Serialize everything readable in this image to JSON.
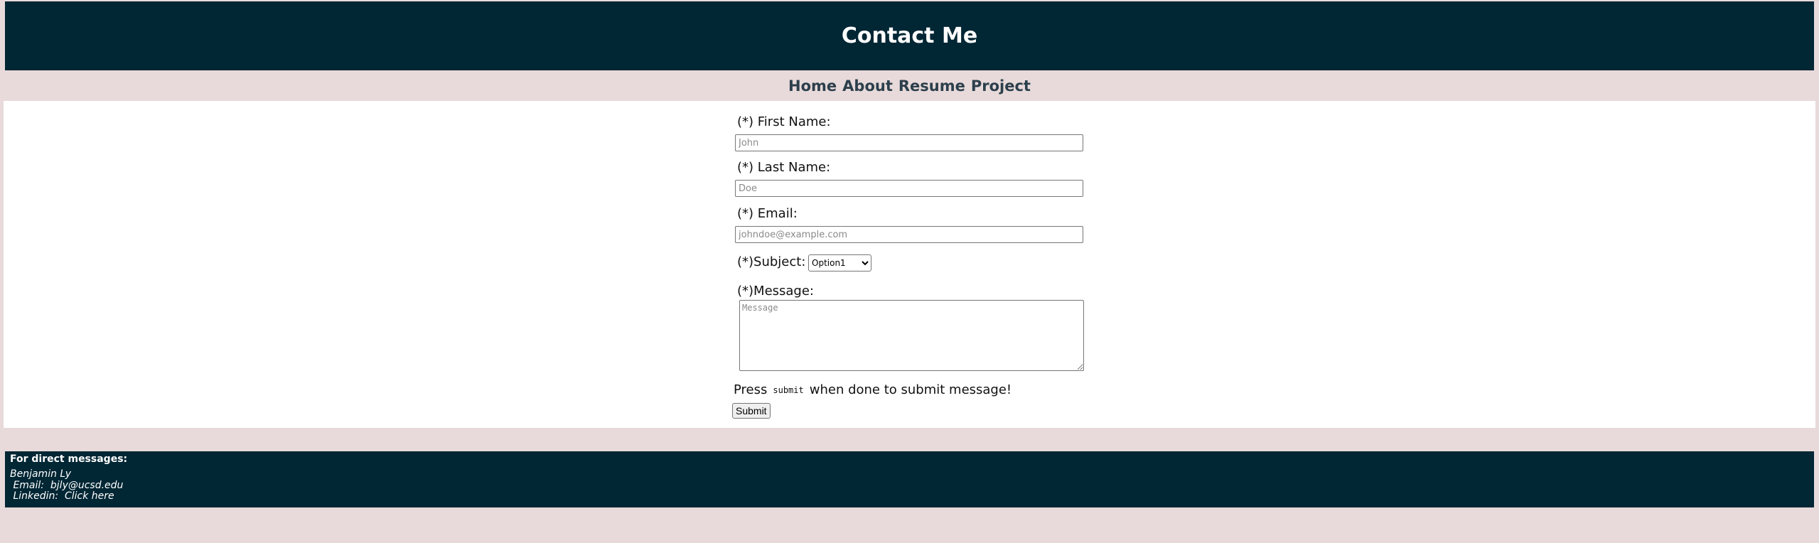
{
  "header": {
    "title": "Contact Me"
  },
  "nav": {
    "items": [
      "Home",
      "About",
      "Resume",
      "Project"
    ]
  },
  "form": {
    "first_name_label": "(*) First Name:",
    "first_name_placeholder": "John",
    "last_name_label": "(*) Last Name:",
    "last_name_placeholder": "Doe",
    "email_label": "(*) Email:",
    "email_placeholder": "johndoe@example.com",
    "subject_label": "(*)Subject:",
    "subject_selected": "Option1",
    "message_label": "(*)Message:",
    "message_placeholder": "Message",
    "press_prefix": "Press",
    "press_code": "submit",
    "press_suffix": "when done to submit message!",
    "submit_label": "Submit"
  },
  "footer": {
    "title": "For direct messages:",
    "name": "Benjamin Ly",
    "email_line": " Email:  bjly@ucsd.edu",
    "linkedin_line": " Linkedin:  Click here"
  },
  "colors": {
    "header_bg": "#012634",
    "page_bg": "#e8dada",
    "nav_text": "#2c3f4c"
  }
}
